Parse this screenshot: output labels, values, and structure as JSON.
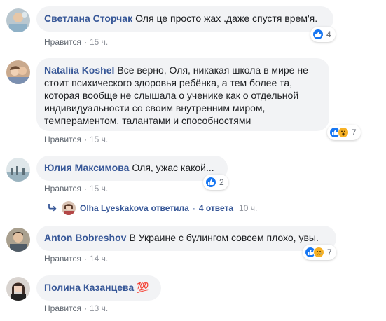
{
  "comments": [
    {
      "author": "Светлана Сторчак",
      "text": "Оля це просто жах .даже спустя врем'я.",
      "like_label": "Нравится",
      "time": "15 ч.",
      "reaction_count": "4"
    },
    {
      "author": "Nataliia Koshel",
      "text": "Все верно, Оля, никакая школа в мире не стоит психического здоровья ребёнка, а тем более та, которая вообще не слышала о ученике как о отдельной индивидуальности со своим внутренним миром, темпераментом, талантами и способностями",
      "like_label": "Нравится",
      "time": "15 ч.",
      "reaction_count": "7"
    },
    {
      "author": "Юлия Максимова",
      "text": "Оля, ужас какой...",
      "like_label": "Нравится",
      "time": "15 ч.",
      "reaction_count": "2"
    },
    {
      "author": "Anton Bobreshov",
      "text": "В Украине с булингом совсем плохо, увы.",
      "like_label": "Нравится",
      "time": "14 ч.",
      "reaction_count": "7"
    },
    {
      "author": "Полина Казанцева",
      "text": "💯",
      "like_label": "Нравится",
      "time": "13 ч."
    }
  ],
  "replies": {
    "author": "Olha Lyeskakova",
    "verb": "ответила",
    "count": "4 ответа",
    "time": "10 ч."
  },
  "separator": "·",
  "icons": {
    "like": "like-reaction-icon",
    "wow": "wow-reaction-icon",
    "sad": "sad-reaction-icon",
    "reply_arrow": "reply-arrow-icon"
  },
  "colors": {
    "link": "#385898",
    "bubble": "#f2f3f5",
    "like_blue": "#1877f2",
    "emoji_yellow": "#f7b125"
  }
}
